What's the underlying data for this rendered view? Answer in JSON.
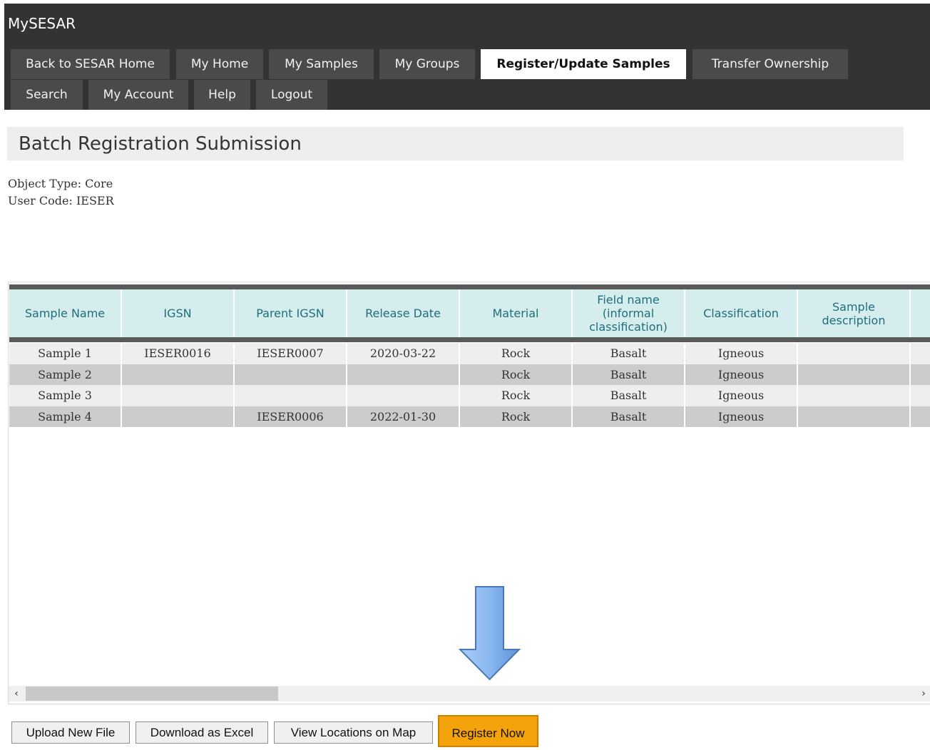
{
  "app": {
    "title": "MySESAR"
  },
  "nav": {
    "tabs": [
      {
        "label": "Back to SESAR Home"
      },
      {
        "label": "My Home"
      },
      {
        "label": "My Samples"
      },
      {
        "label": "My Groups"
      },
      {
        "label": "Register/Update Samples",
        "active": true
      },
      {
        "label": "Transfer Ownership"
      },
      {
        "label": "Search"
      },
      {
        "label": "My Account"
      },
      {
        "label": "Help"
      },
      {
        "label": "Logout"
      }
    ]
  },
  "page": {
    "title": "Batch Registration Submission",
    "object_type": "Object Type: Core",
    "user_code": "User Code: IESER"
  },
  "table": {
    "columns": [
      "Sample Name",
      "IGSN",
      "Parent IGSN",
      "Release Date",
      "Material",
      "Field name (informal classification)",
      "Classification",
      "Sample description"
    ],
    "rows": [
      [
        "Sample 1",
        "IESER0016",
        "IESER0007",
        "2020-03-22",
        "Rock",
        "Basalt",
        "Igneous",
        ""
      ],
      [
        "Sample 2",
        "",
        "",
        "",
        "Rock",
        "Basalt",
        "Igneous",
        ""
      ],
      [
        "Sample 3",
        "",
        "",
        "",
        "Rock",
        "Basalt",
        "Igneous",
        ""
      ],
      [
        "Sample 4",
        "",
        "IESER0006",
        "2022-01-30",
        "Rock",
        "Basalt",
        "Igneous",
        ""
      ]
    ]
  },
  "scrollbar": {
    "left_icon": "‹",
    "right_icon": "›"
  },
  "actions": {
    "upload": "Upload New File",
    "download": "Download as Excel",
    "map": "View Locations on Map",
    "register": "Register Now"
  },
  "colors": {
    "topbar": "#333333",
    "tab": "#4a4a4a",
    "header_cell": "#d5eded",
    "header_text": "#1f6f7d",
    "register_button": "#f5a30a",
    "arrow": "#7fb0ec"
  },
  "icons": {
    "hint_arrow": "down-arrow-icon"
  }
}
